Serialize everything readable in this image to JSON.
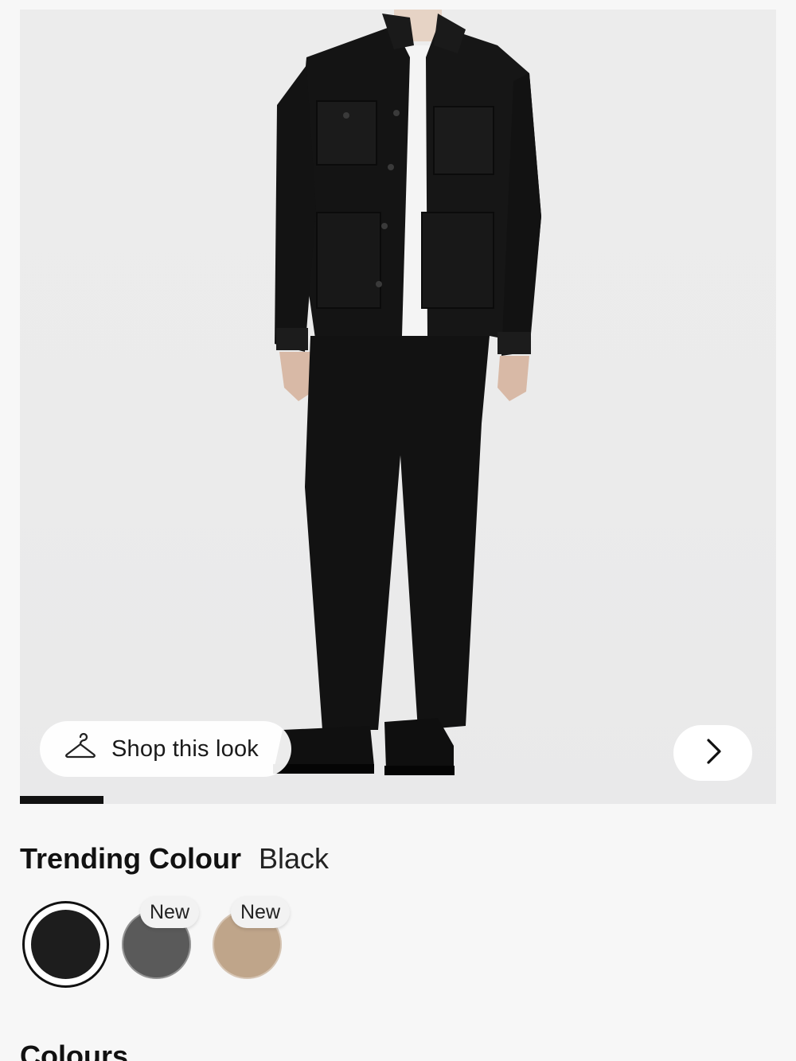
{
  "product_image": {
    "alt": "",
    "shop_look_label": "Shop this look",
    "gallery_progress": 0.11
  },
  "icons": {
    "shop_look": "hanger-icon",
    "next": "chevron-right-icon"
  },
  "trending": {
    "title": "Trending Colour",
    "value": "Black"
  },
  "swatches": [
    {
      "color": "#1d1d1d",
      "selected": true,
      "badge": ""
    },
    {
      "color": "#5a5a5a",
      "selected": false,
      "badge": "New"
    },
    {
      "color": "#bfa58a",
      "selected": false,
      "badge": "New"
    }
  ],
  "colours_heading": "Colours"
}
